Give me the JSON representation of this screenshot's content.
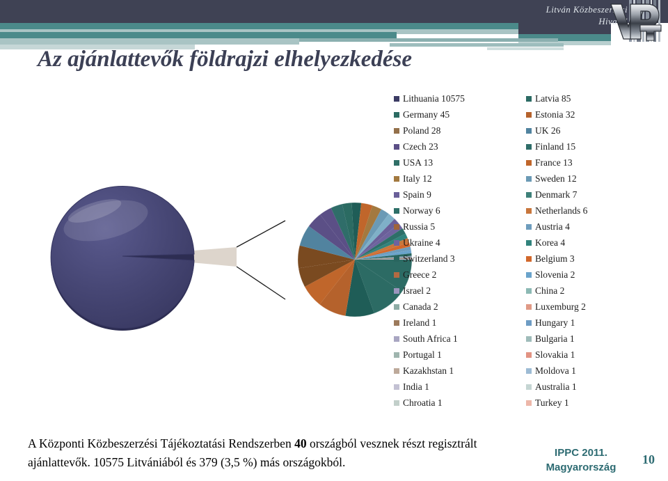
{
  "header": {
    "org_line1": "Litván Közbeszerzési",
    "org_line2": "Hivatal",
    "logo_text": "VPT",
    "logo_name": "vpt-logo"
  },
  "title": "Az ajánlattevők földrajzi elhelyezkedése",
  "footnote_part1": "A Központi Közbeszerzési Tájékoztatási Rendszerben ",
  "footnote_bold": "40",
  "footnote_part2": " országból vesznek részt regisztrált ajánlattevők. 10575 Litvániából és 379 (3,5 %) más országokból.",
  "conference_line1": "IPPC 2011.",
  "conference_line2": "Magyarország",
  "page_number": "10",
  "chart_data": {
    "type": "pie",
    "title": "Az ajánlattevők földrajzi elhelyezkedése",
    "subtype": "pie-of-pie",
    "main_pie": {
      "slices": [
        {
          "label": "Lithuania",
          "value": 10575,
          "color": "#464673"
        },
        {
          "label": "Other (40 countries)",
          "value": 379,
          "color": "#ddd5cc"
        }
      ]
    },
    "secondary_pie_total": 379,
    "legend_columns": [
      [
        {
          "label": "Lithuania",
          "value": 10575,
          "text": "Lithuania  10575",
          "color": "#3b3b64"
        },
        {
          "label": "Germany",
          "value": 45,
          "text": "Germany 45",
          "color": "#2b6b62"
        },
        {
          "label": "Poland",
          "value": 28,
          "text": "Poland 28",
          "color": "#94704a"
        },
        {
          "label": "Czech",
          "value": 23,
          "text": "Czech 23",
          "color": "#5b4f86"
        },
        {
          "label": "USA",
          "value": 13,
          "text": "USA 13",
          "color": "#2f6f67"
        },
        {
          "label": "Italy",
          "value": 12,
          "text": "Italy 12",
          "color": "#a3793f"
        },
        {
          "label": "Spain",
          "value": 9,
          "text": "Spain 9",
          "color": "#6a5f99"
        },
        {
          "label": "Norway",
          "value": 6,
          "text": "Norway 6",
          "color": "#2d6f68"
        },
        {
          "label": "Russia",
          "value": 5,
          "text": "Russia 5",
          "color": "#a0643a"
        },
        {
          "label": "Ukraine",
          "value": 4,
          "text": "Ukraine 4",
          "color": "#6e639e"
        },
        {
          "label": "Switzerland",
          "value": 3,
          "text": "Switzerland 3",
          "color": "#29655f"
        },
        {
          "label": "Greece",
          "value": 2,
          "text": "Greece 2",
          "color": "#b26a42"
        },
        {
          "label": "Israel",
          "value": 2,
          "text": "Israel 2",
          "color": "#9b95bd"
        },
        {
          "label": "Canada",
          "value": 2,
          "text": "Canada 2",
          "color": "#8fada6"
        },
        {
          "label": "Ireland",
          "value": 1,
          "text": "Ireland 1",
          "color": "#9c7a5c"
        },
        {
          "label": "South Africa",
          "value": 1,
          "text": "South Africa 1",
          "color": "#a9a6c2"
        },
        {
          "label": "Portugal",
          "value": 1,
          "text": "Portugal 1",
          "color": "#9fb5ae"
        },
        {
          "label": "Kazakhstan",
          "value": 1,
          "text": "Kazakhstan 1",
          "color": "#bda99a"
        },
        {
          "label": "India",
          "value": 1,
          "text": "India 1",
          "color": "#c3c1d3"
        },
        {
          "label": "Chroatia",
          "value": 1,
          "text": "Chroatia 1",
          "color": "#c2cfca"
        }
      ],
      [
        {
          "label": "Latvia",
          "value": 85,
          "text": "Latvia 85",
          "color": "#2c6b64"
        },
        {
          "label": "Estonia",
          "value": 32,
          "text": "Estonia 32",
          "color": "#b5622c"
        },
        {
          "label": "UK",
          "value": 26,
          "text": "UK 26",
          "color": "#51839f"
        },
        {
          "label": "Finland",
          "value": 15,
          "text": "Finland 15",
          "color": "#2f6d69"
        },
        {
          "label": "France",
          "value": 13,
          "text": "France 13",
          "color": "#c0662b"
        },
        {
          "label": "Sweden",
          "value": 12,
          "text": "Sweden 12",
          "color": "#6b9ab5"
        },
        {
          "label": "Denmark",
          "value": 7,
          "text": "Denmark 7",
          "color": "#3e8079"
        },
        {
          "label": "Netherlands",
          "value": 6,
          "text": "Netherlands 6",
          "color": "#c8763c"
        },
        {
          "label": "Austria",
          "value": 4,
          "text": "Austria 4",
          "color": "#6e9dbd"
        },
        {
          "label": "Korea",
          "value": 4,
          "text": "Korea 4",
          "color": "#31837c"
        },
        {
          "label": "Belgium",
          "value": 3,
          "text": "Belgium 3",
          "color": "#d2682c"
        },
        {
          "label": "Slovenia",
          "value": 2,
          "text": "Slovenia 2",
          "color": "#6aa3cb"
        },
        {
          "label": "China",
          "value": 2,
          "text": "China 2",
          "color": "#8cb9b4"
        },
        {
          "label": "Luxemburg",
          "value": 2,
          "text": "Luxemburg 2",
          "color": "#e09a86"
        },
        {
          "label": "Hungary",
          "value": 1,
          "text": "Hungary 1",
          "color": "#6e9cc4"
        },
        {
          "label": "Bulgaria",
          "value": 1,
          "text": "Bulgaria 1",
          "color": "#9fbcba"
        },
        {
          "label": "Slovakia",
          "value": 1,
          "text": "Slovakia 1",
          "color": "#e29383"
        },
        {
          "label": "Moldova",
          "value": 1,
          "text": "Moldova 1",
          "color": "#9dbbd4"
        },
        {
          "label": "Australia",
          "value": 1,
          "text": "Australia 1",
          "color": "#c5d5d3"
        },
        {
          "label": "Turkey",
          "value": 1,
          "text": "Turkey 1",
          "color": "#edb7a9"
        }
      ]
    ]
  },
  "colors": {
    "header_navy": "#3f4254",
    "header_teal": "#4b8a8a",
    "title_text": "#3c4055",
    "accent_teal": "#2d6b72"
  }
}
